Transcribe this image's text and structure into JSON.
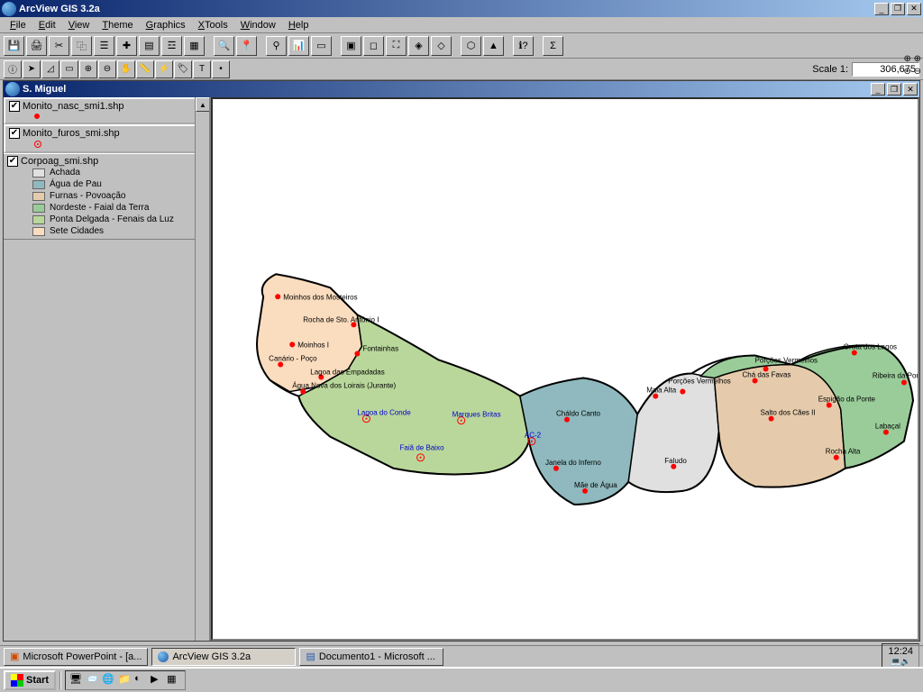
{
  "app": {
    "title": "ArcView GIS 3.2a"
  },
  "menu": {
    "file": "File",
    "edit": "Edit",
    "view": "View",
    "theme": "Theme",
    "graphics": "Graphics",
    "xtools": "XTools",
    "window": "Window",
    "help": "Help"
  },
  "scale": {
    "label": "Scale 1:",
    "value": "306,675"
  },
  "docwindow": {
    "title": "S. Miguel"
  },
  "toc": {
    "layers": [
      {
        "name": "Monito_nasc_smi1.shp",
        "checked": true,
        "symbol": "dot"
      },
      {
        "name": "Monito_furos_smi.shp",
        "checked": true,
        "symbol": "odot"
      },
      {
        "name": "Corpoag_smi.shp",
        "checked": true,
        "symbol": "poly",
        "classes": [
          {
            "label": "Achada",
            "color": "#e0e0e0"
          },
          {
            "label": "Água de Pau",
            "color": "#8fb9be"
          },
          {
            "label": "Furnas - Povoação",
            "color": "#e5cbab"
          },
          {
            "label": "Nordeste - Faial da Terra",
            "color": "#99cc99"
          },
          {
            "label": "Ponta Delgada - Fenais da Luz",
            "color": "#b9d79b"
          },
          {
            "label": "Sete Cidades",
            "color": "#fadcbe"
          }
        ]
      }
    ]
  },
  "map": {
    "nasc_labels": [
      "Moinhos dos Mosteiros",
      "Rocha de Sto. António I",
      "Moinhos I",
      "Fontainhas",
      "Canário - Poço",
      "Lagoa das Empadadas",
      "Água Nova dos Loirais (Jurante)",
      "Cháldo Canto",
      "Porções Vermelhos",
      "Maia Alta",
      "Chá das Favas",
      "Porções Vermelhos",
      "Grota dos Lagos",
      "Ribeira da Ponte",
      "Espigão da Ponte",
      "Salto dos Cães II",
      "Labaçal",
      "Rocha Alta",
      "Faludo",
      "Janela do Inferno",
      "Mãe de Água"
    ],
    "furos_labels": [
      "Lagoa do Conde",
      "Marques Britas",
      "AC-2",
      "Faiã de Baixo"
    ]
  },
  "taskbar": {
    "start": "Start",
    "items": [
      "Microsoft PowerPoint - [a...",
      "ArcView GIS 3.2a",
      "Documento1 - Microsoft ..."
    ],
    "clock": "12:24"
  }
}
